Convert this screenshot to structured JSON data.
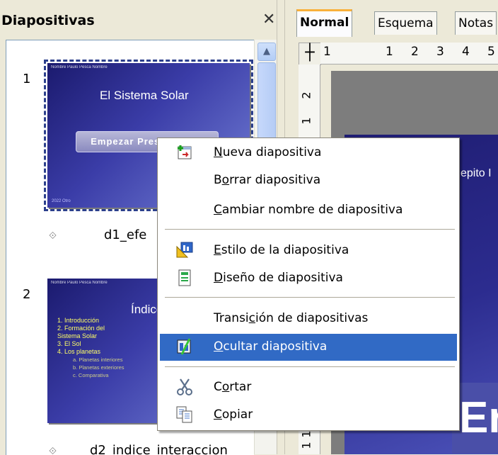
{
  "pane": {
    "title": "Diapositivas",
    "close_glyph": "✕"
  },
  "slides": [
    {
      "number": "1",
      "name": "d1_efe",
      "thumb_top": "Nombre   Paulo Pesca Nombre",
      "thumb_title": "El Sistema Solar",
      "thumb_button": "Empezar Presentación",
      "thumb_bottom": "2022 Otro"
    },
    {
      "number": "2",
      "name": "d2_indice_interaccion",
      "thumb_top": "Nombre   Paulo Pesca Nombre",
      "thumb_title": "Índice",
      "thumb_items": [
        "1. Introducción",
        "2. Formación del",
        "Sistema Solar",
        "3. El Sol",
        "4. Los planetas"
      ],
      "thumb_subitems": [
        "a. Planetas interiores",
        "b. Planetas exteriores",
        "c. Comparativa"
      ]
    }
  ],
  "tabs": [
    "Normal",
    "Esquema",
    "Notas"
  ],
  "ruler": {
    "h_ticks": [
      "1",
      "1",
      "2",
      "3",
      "4",
      "5"
    ],
    "v_ticks": [
      "2",
      "1",
      "1",
      "1"
    ]
  },
  "slide_view": {
    "partial_text": "epito I",
    "partial_button": "Er"
  },
  "context_menu": {
    "items": [
      {
        "pre": "",
        "u": "N",
        "post": "ueva diapositiva",
        "icon": "new-slide-icon"
      },
      {
        "pre": "B",
        "u": "o",
        "post": "rrar diapositiva",
        "icon": ""
      },
      {
        "pre": "",
        "u": "C",
        "post": "ambiar nombre de diapositiva",
        "icon": ""
      },
      {
        "pre": "",
        "u": "E",
        "post": "stilo de la diapositiva",
        "icon": "slide-style-icon"
      },
      {
        "pre": "",
        "u": "D",
        "post": "iseño de diapositiva",
        "icon": "slide-layout-icon"
      },
      {
        "pre": "Transi",
        "u": "c",
        "post": "ión de diapositivas",
        "icon": ""
      },
      {
        "pre": "",
        "u": "O",
        "post": "cultar diapositiva",
        "icon": "hide-slide-icon"
      },
      {
        "pre": "C",
        "u": "o",
        "post": "rtar",
        "icon": "scissors-icon"
      },
      {
        "pre": "",
        "u": "C",
        "post": "opiar",
        "icon": "copy-icon"
      }
    ],
    "highlight_color": "#316ac5"
  }
}
